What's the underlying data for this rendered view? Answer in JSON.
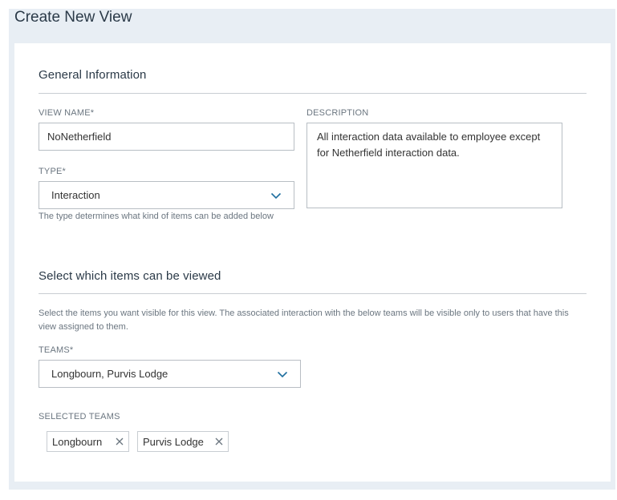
{
  "page": {
    "title": "Create New View"
  },
  "general": {
    "section_title": "General Information",
    "view_name": {
      "label": "VIEW NAME*",
      "value": "NoNetherfield"
    },
    "description": {
      "label": "DESCRIPTION",
      "value": "All interaction data available to employee except for Netherfield interaction data."
    },
    "type": {
      "label": "TYPE*",
      "value": "Interaction",
      "help": "The type determines what kind of items can be added below"
    }
  },
  "items": {
    "section_title": "Select which items can be viewed",
    "help": "Select the items you want visible for this view. The associated interaction with the below teams will be visible only to users that have this view assigned to them.",
    "teams": {
      "label": "TEAMS*",
      "value": "Longbourn, Purvis Lodge"
    },
    "selected_teams": {
      "label": "SELECTED TEAMS",
      "chips": [
        "Longbourn",
        "Purvis Lodge"
      ]
    }
  },
  "icons": {
    "dropdown": "chevron-down-icon",
    "remove": "close-icon"
  },
  "colors": {
    "background": "#e8eef4",
    "card": "#ffffff",
    "accent": "#1f6f9f"
  }
}
